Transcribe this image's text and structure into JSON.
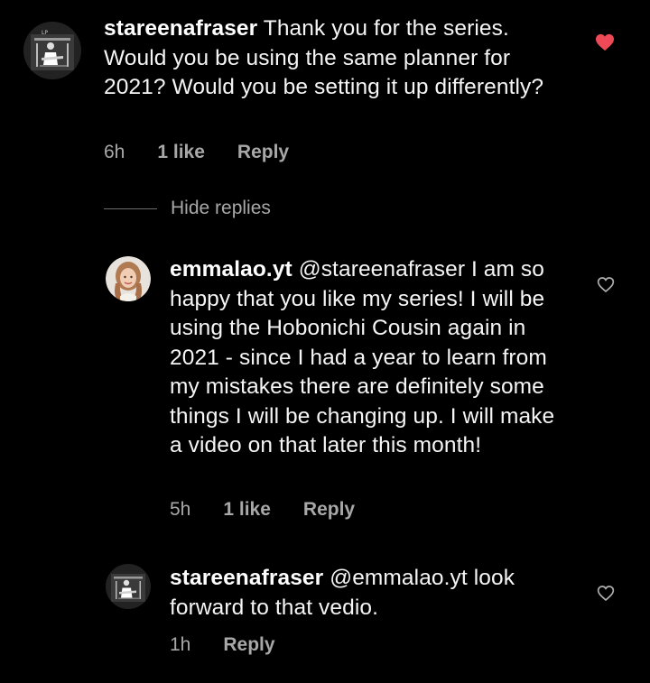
{
  "comments": [
    {
      "username": "stareenafraser",
      "text": "Thank you for the series. Would you be using the same planner for 2021? Would you be setting it up differently?",
      "time": "6h",
      "likes": "1 like",
      "reply": "Reply",
      "liked": true
    },
    {
      "username": "emmalao.yt",
      "text": "@stareenafraser I am so happy that you like my series! I will be using the Hobonichi Cousin again in 2021 - since I had a year to learn from my mistakes there are definitely some things I will be changing up. I will make a video on that later this month!",
      "time": "5h",
      "likes": "1 like",
      "reply": "Reply",
      "liked": false
    },
    {
      "username": "stareenafraser",
      "text": "@emmalao.yt look forward to that vedio.",
      "time": "1h",
      "likes": "",
      "reply": "Reply",
      "liked": false
    }
  ],
  "thread": {
    "hide_replies": "Hide replies"
  },
  "colors": {
    "background": "#000000",
    "text": "#f5f5f5",
    "secondary": "#a8a8a8",
    "heart_liked": "#ed4956"
  },
  "icons": {
    "liked": "heart-filled-icon",
    "unliked": "heart-outline-icon"
  }
}
